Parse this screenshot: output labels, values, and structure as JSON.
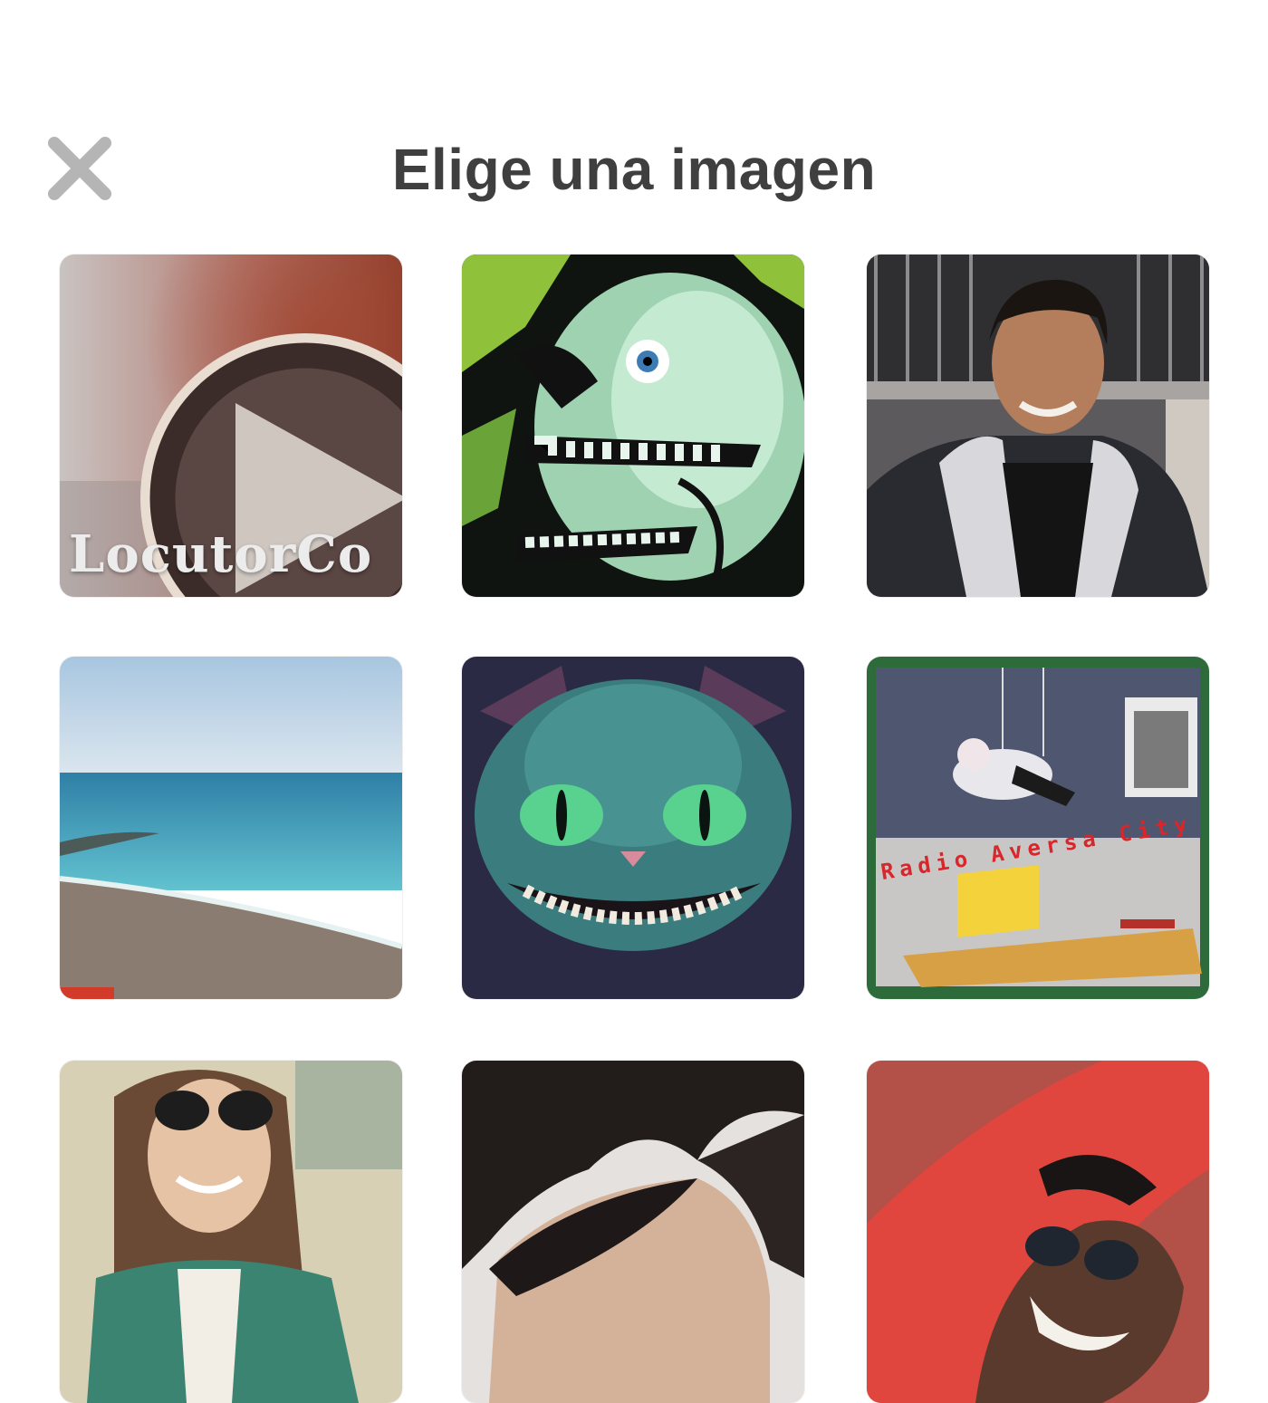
{
  "header": {
    "title": "Elige una imagen",
    "close_icon": "close-icon"
  },
  "tiles": [
    {
      "overlay_text": "LocutorCo",
      "icon": "play-icon"
    },
    {},
    {},
    {},
    {},
    {
      "overlay_text": "Radio Aversa City"
    },
    {},
    {},
    {}
  ],
  "colors": {
    "title": "#3f3f3f",
    "close_icon": "#b5b5b5",
    "background": "#ffffff"
  }
}
